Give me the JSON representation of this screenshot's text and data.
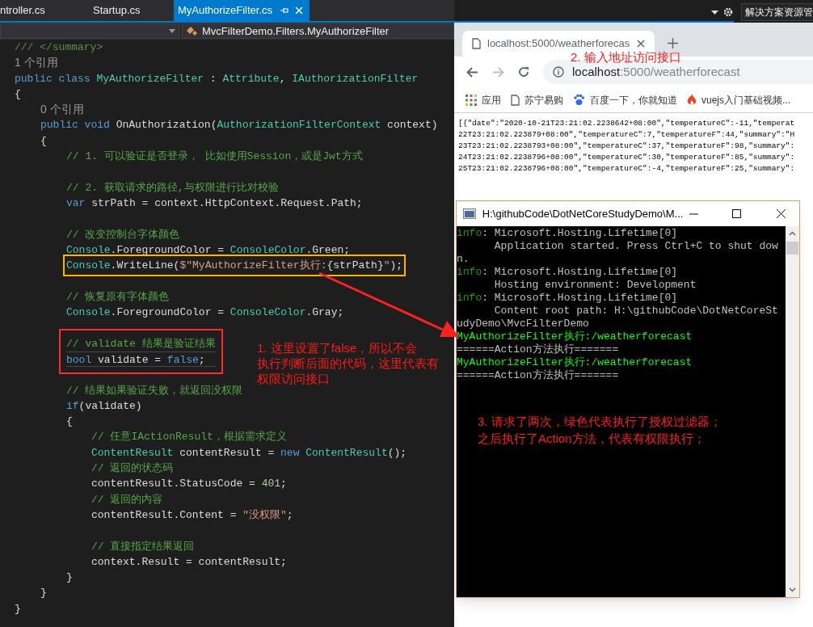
{
  "editor": {
    "tabs": [
      {
        "label": "ntroller.cs",
        "selected": false
      },
      {
        "label": "Startup.cs",
        "selected": false
      },
      {
        "label": "MyAuthorizeFilter.cs",
        "selected": true
      }
    ],
    "solution_explorer": {
      "label": "解决方案资源管"
    },
    "nav_bar": {
      "member": "MvcFilterDemo.Filters.MyAuthorizeFilter"
    },
    "code": [
      {
        "kind": "line",
        "tokens": [
          {
            "kind": "doc",
            "text": "/// </summary>"
          }
        ]
      },
      {
        "kind": "line",
        "tokens": [
          {
            "kind": "ref",
            "text": "1 个引用"
          }
        ]
      },
      {
        "kind": "line",
        "tokens": [
          {
            "kind": "keyword",
            "text": "public class "
          },
          {
            "kind": "type",
            "text": "MyAuthorizeFilter"
          },
          {
            "kind": "plain",
            "text": " : "
          },
          {
            "kind": "type",
            "text": "Attribute"
          },
          {
            "kind": "plain",
            "text": ", "
          },
          {
            "kind": "type",
            "text": "IAuthorizationFilter"
          }
        ]
      },
      {
        "kind": "line",
        "tokens": [
          {
            "kind": "plain",
            "text": "{"
          }
        ]
      },
      {
        "kind": "block",
        "children": [
          {
            "kind": "line",
            "tokens": [
              {
                "kind": "ref",
                "text": "0 个引用"
              }
            ]
          },
          {
            "kind": "line",
            "tokens": [
              {
                "kind": "keyword",
                "text": "public void "
              },
              {
                "kind": "plain",
                "text": "OnAuthorization("
              },
              {
                "kind": "type",
                "text": "AuthorizationFilterContext"
              },
              {
                "kind": "plain",
                "text": " context)"
              }
            ]
          },
          {
            "kind": "line",
            "tokens": [
              {
                "kind": "plain",
                "text": "{"
              }
            ]
          },
          {
            "kind": "block",
            "children": [
              {
                "kind": "line",
                "tokens": [
                  {
                    "kind": "comment",
                    "text": "// 1. 可以验证是否登录， 比如使用Session，或是Jwt方式"
                  }
                ]
              },
              {
                "kind": "blank"
              },
              {
                "kind": "line",
                "tokens": [
                  {
                    "kind": "comment",
                    "text": "// 2. 获取请求的路径,与权限进行比对校验"
                  }
                ]
              },
              {
                "kind": "line",
                "tokens": [
                  {
                    "kind": "keyword",
                    "text": "var"
                  },
                  {
                    "kind": "plain",
                    "text": " strPath = context.HttpContext.Request.Path;"
                  }
                ]
              },
              {
                "kind": "blank"
              },
              {
                "kind": "line",
                "tokens": [
                  {
                    "kind": "comment",
                    "text": "// 改变控制台字体颜色"
                  }
                ]
              },
              {
                "kind": "line",
                "tokens": [
                  {
                    "kind": "type",
                    "text": "Console"
                  },
                  {
                    "kind": "plain",
                    "text": ".ForegroundColor = "
                  },
                  {
                    "kind": "type",
                    "text": "ConsoleColor"
                  },
                  {
                    "kind": "plain",
                    "text": ".Green;"
                  }
                ]
              },
              {
                "kind": "boxed",
                "color": "#ffb300",
                "children": [
                  {
                    "kind": "line",
                    "tokens": [
                      {
                        "kind": "type",
                        "text": "Console"
                      },
                      {
                        "kind": "plain",
                        "text": ".WriteLine("
                      },
                      {
                        "kind": "string",
                        "text": "$\"MyAuthorizeFilter执行:"
                      },
                      {
                        "kind": "plain",
                        "text": "{strPath}"
                      },
                      {
                        "kind": "string",
                        "text": "\""
                      },
                      {
                        "kind": "plain",
                        "text": ");"
                      }
                    ]
                  }
                ]
              },
              {
                "kind": "blank"
              },
              {
                "kind": "line",
                "tokens": [
                  {
                    "kind": "comment",
                    "text": "// 恢复原有字体颜色"
                  }
                ]
              },
              {
                "kind": "line",
                "tokens": [
                  {
                    "kind": "type",
                    "text": "Console"
                  },
                  {
                    "kind": "plain",
                    "text": ".ForegroundColor = "
                  },
                  {
                    "kind": "type",
                    "text": "ConsoleColor"
                  },
                  {
                    "kind": "plain",
                    "text": ".Gray;"
                  }
                ]
              },
              {
                "kind": "blank"
              },
              {
                "kind": "boxed",
                "color": "#ff2a2a",
                "children": [
                  {
                    "kind": "line",
                    "tokens": [
                      {
                        "kind": "comment",
                        "text": "// validate 结果是验证结果"
                      }
                    ]
                  },
                  {
                    "kind": "line",
                    "current": true,
                    "tokens": [
                      {
                        "kind": "keyword",
                        "text": "bool"
                      },
                      {
                        "kind": "plain",
                        "text": " validate = "
                      },
                      {
                        "kind": "keyword",
                        "text": "false"
                      },
                      {
                        "kind": "plain",
                        "text": ";"
                      }
                    ]
                  }
                ]
              },
              {
                "kind": "blank"
              },
              {
                "kind": "line",
                "tokens": [
                  {
                    "kind": "comment",
                    "text": "// 结果如果验证失败，就返回没权限"
                  }
                ]
              },
              {
                "kind": "line",
                "tokens": [
                  {
                    "kind": "keyword",
                    "text": "if"
                  },
                  {
                    "kind": "plain",
                    "text": "(validate)"
                  }
                ]
              },
              {
                "kind": "line",
                "tokens": [
                  {
                    "kind": "plain",
                    "text": "{"
                  }
                ]
              },
              {
                "kind": "block",
                "children": [
                  {
                    "kind": "line",
                    "tokens": [
                      {
                        "kind": "comment",
                        "text": "// 任意IActionResult，根据需求定义"
                      }
                    ]
                  },
                  {
                    "kind": "line",
                    "tokens": [
                      {
                        "kind": "type",
                        "text": "ContentResult"
                      },
                      {
                        "kind": "plain",
                        "text": " contentResult = "
                      },
                      {
                        "kind": "keyword",
                        "text": "new "
                      },
                      {
                        "kind": "type",
                        "text": "ContentResult"
                      },
                      {
                        "kind": "plain",
                        "text": "();"
                      }
                    ]
                  },
                  {
                    "kind": "line",
                    "tokens": [
                      {
                        "kind": "comment",
                        "text": "// 返回的状态码"
                      }
                    ]
                  },
                  {
                    "kind": "line",
                    "tokens": [
                      {
                        "kind": "plain",
                        "text": "contentResult.StatusCode = "
                      },
                      {
                        "kind": "number",
                        "text": "401"
                      },
                      {
                        "kind": "plain",
                        "text": ";"
                      }
                    ]
                  },
                  {
                    "kind": "line",
                    "tokens": [
                      {
                        "kind": "comment",
                        "text": "// 返回的内容"
                      }
                    ]
                  },
                  {
                    "kind": "line",
                    "tokens": [
                      {
                        "kind": "plain",
                        "text": "contentResult.Content = "
                      },
                      {
                        "kind": "string",
                        "text": "\"没权限\""
                      },
                      {
                        "kind": "plain",
                        "text": ";"
                      }
                    ]
                  },
                  {
                    "kind": "blank"
                  },
                  {
                    "kind": "line",
                    "tokens": [
                      {
                        "kind": "comment",
                        "text": "// 直接指定结果返回"
                      }
                    ]
                  },
                  {
                    "kind": "line",
                    "tokens": [
                      {
                        "kind": "plain",
                        "text": "context.Result = contentResult;"
                      }
                    ]
                  }
                ]
              },
              {
                "kind": "line",
                "tokens": [
                  {
                    "kind": "plain",
                    "text": "}"
                  }
                ]
              }
            ]
          },
          {
            "kind": "line",
            "tokens": [
              {
                "kind": "plain",
                "text": "}"
              }
            ]
          }
        ]
      },
      {
        "kind": "line",
        "tokens": [
          {
            "kind": "plain",
            "text": "}"
          }
        ]
      }
    ],
    "annotation": {
      "lines": [
        "1. 这里设置了false，所以不会",
        "执行判断后面的代码，这里代表有",
        "权限访问接口"
      ]
    }
  },
  "browser": {
    "tab": {
      "title": "localhost:5000/weatherforecas"
    },
    "address": {
      "host": "localhost",
      "path": ":5000/weatherforecast"
    },
    "annotation": {
      "text": "2. 输入地址访问接口"
    },
    "bookmarks": [
      {
        "kind": "apps",
        "label": "应用"
      },
      {
        "kind": "page",
        "label": "苏宁易购"
      },
      {
        "kind": "paw",
        "label": "百度一下，你就知道"
      },
      {
        "kind": "flame",
        "label": "vuejs入门基础视频..."
      }
    ],
    "body_lines": [
      "[{\"date\":\"2020-10-21T23:21:02.2238642+08:00\",\"temperatureC\":-11,\"temperat",
      "22T23:21:02.223879+08:00\",\"temperatureC\":7,\"temperatureF\":44,\"summary\":\"H",
      "23T23:21:02.2238793+08:00\",\"temperatureC\":37,\"temperatureF\":98,\"summary\":",
      "24T23:21:02.2238796+08:00\",\"temperatureC\":30,\"temperatureF\":85,\"summary\":",
      "25T23:21:02.2238796+08:00\",\"temperatureC\":-4,\"temperatureF\":25,\"summary\":"
    ]
  },
  "console": {
    "title": "H:\\githubCode\\DotNetCoreStudyDemo\\M...",
    "lines": [
      {
        "kind": "info",
        "prefix": "info",
        "text": ": Microsoft.Hosting.Lifetime[0]"
      },
      {
        "kind": "plain",
        "text": "      Application started. Press Ctrl+C to shut dow"
      },
      {
        "kind": "plain",
        "text": "n."
      },
      {
        "kind": "info",
        "prefix": "info",
        "text": ": Microsoft.Hosting.Lifetime[0]"
      },
      {
        "kind": "plain",
        "text": "      Hosting environment: Development"
      },
      {
        "kind": "info",
        "prefix": "info",
        "text": ": Microsoft.Hosting.Lifetime[0]"
      },
      {
        "kind": "plain",
        "text": "      Content root path: H:\\githubCode\\DotNetCoreSt"
      },
      {
        "kind": "plain",
        "text": "udyDemo\\MvcFilterDemo"
      },
      {
        "kind": "green",
        "text": "MyAuthorizeFilter执行:/weatherforecast"
      },
      {
        "kind": "plain",
        "text": "======Action方法执行======="
      },
      {
        "kind": "green",
        "text": "MyAuthorizeFilter执行:/weatherforecast"
      },
      {
        "kind": "plain",
        "text": "======Action方法执行======="
      }
    ],
    "annotation": {
      "lines": [
        "3. 请求了两次，绿色代表执行了授权过滤器；",
        "之后执行了Action方法，代表有权限执行；"
      ]
    }
  }
}
